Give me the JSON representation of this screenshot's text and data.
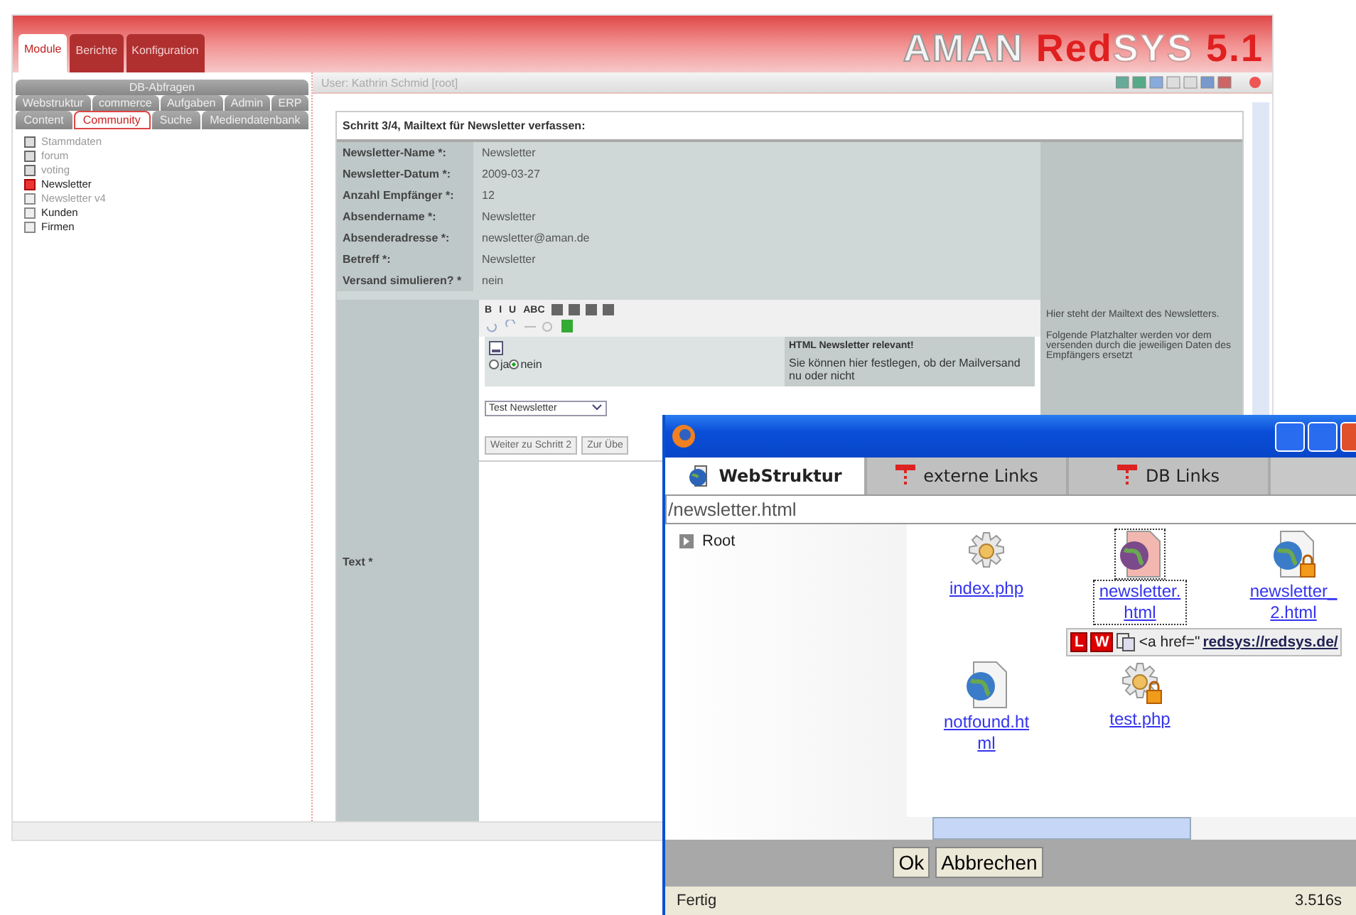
{
  "app": {
    "top_tabs": [
      {
        "label": "Module",
        "selected": true
      },
      {
        "label": "Berichte",
        "selected": false
      },
      {
        "label": "Konfiguration",
        "selected": false
      }
    ],
    "logo": {
      "brand": "AMAN",
      "accent": "Red",
      "rest": "SYS",
      "version": "5.1"
    },
    "user": "User: Kathrin Schmid [root]",
    "sidebar": {
      "tab_rows": [
        [
          {
            "label": "DB-Abfragen",
            "selected": false
          }
        ],
        [
          {
            "label": "Webstruktur",
            "selected": false
          },
          {
            "label": "commerce",
            "selected": false
          },
          {
            "label": "Aufgaben",
            "selected": false
          },
          {
            "label": "Admin",
            "selected": false
          },
          {
            "label": "ERP",
            "selected": false
          }
        ],
        [
          {
            "label": "Content",
            "selected": false
          },
          {
            "label": "Community",
            "selected": true
          },
          {
            "label": "Suche",
            "selected": false
          },
          {
            "label": "Mediendatenbank",
            "selected": false
          }
        ]
      ],
      "items": [
        {
          "label": "Stammdaten",
          "disabled": true,
          "selected": false,
          "expandable": true
        },
        {
          "label": "forum",
          "disabled": true,
          "selected": false,
          "expandable": true
        },
        {
          "label": "voting",
          "disabled": true,
          "selected": false,
          "expandable": true
        },
        {
          "label": "Newsletter",
          "disabled": false,
          "selected": true,
          "expandable": false
        },
        {
          "label": "Newsletter v4",
          "disabled": true,
          "selected": false,
          "expandable": false
        },
        {
          "label": "Kunden",
          "disabled": false,
          "selected": false,
          "expandable": false
        },
        {
          "label": "Firmen",
          "disabled": false,
          "selected": false,
          "expandable": false
        }
      ]
    },
    "form": {
      "title": "Schritt 3/4, Mailtext für Newsletter verfassen:",
      "fields": [
        {
          "label": "Newsletter-Name *:",
          "value": "Newsletter"
        },
        {
          "label": "Newsletter-Datum *:",
          "value": "2009-03-27"
        },
        {
          "label": "Anzahl Empfänger *:",
          "value": "12"
        },
        {
          "label": "Absendername *:",
          "value": "Newsletter"
        },
        {
          "label": "Absenderadresse *:",
          "value": "newsletter@aman.de"
        },
        {
          "label": "Betreff *:",
          "value": "Newsletter"
        },
        {
          "label": "Versand simulieren? *",
          "value": "nein"
        }
      ],
      "help": [
        "Hier steht der Mailtext des Newsletters.",
        "Folgende Platzhalter werden vor dem versenden durch die jeweiligen Daten des Empfängers ersetzt"
      ],
      "text_label": "Text *",
      "editor": {
        "format_buttons": [
          "B",
          "I",
          "U",
          "ABC"
        ],
        "radios": [
          {
            "label": "ja",
            "selected": false
          },
          {
            "label": "nein",
            "selected": true
          }
        ],
        "hint_title": "HTML Newsletter relevant!",
        "hint_body": "Sie können hier festlegen, ob der Mailversand nu oder nicht",
        "select": "Test Newsletter",
        "buttons": [
          "Weiter zu Schritt 2",
          "Zur Übe"
        ]
      }
    }
  },
  "popup": {
    "tabs": [
      {
        "label": "WebStruktur",
        "selected": true
      },
      {
        "label": "externe Links",
        "selected": false
      },
      {
        "label": "DB Links",
        "selected": false
      }
    ],
    "address": "/newsletter.html",
    "tree": [
      {
        "label": "Root"
      }
    ],
    "files": [
      {
        "name": "index.php",
        "kind": "gear",
        "locked": false,
        "selected": false
      },
      {
        "name": "newsletter.html",
        "kind": "globe",
        "locked": false,
        "selected": true
      },
      {
        "name": "newsletter_2.html",
        "kind": "globe",
        "locked": true,
        "selected": false
      },
      {
        "name": "notfound.html",
        "kind": "globe",
        "locked": false,
        "selected": false
      },
      {
        "name": "test.php",
        "kind": "gear",
        "locked": true,
        "selected": false
      }
    ],
    "tooltip": {
      "badges": [
        "L",
        "W"
      ],
      "code": "<a href=\"",
      "link": "redsys://redsys.de/"
    },
    "buttons": [
      "Ok",
      "Abbrechen"
    ],
    "status": "Fertig",
    "timing": "3.516s"
  }
}
